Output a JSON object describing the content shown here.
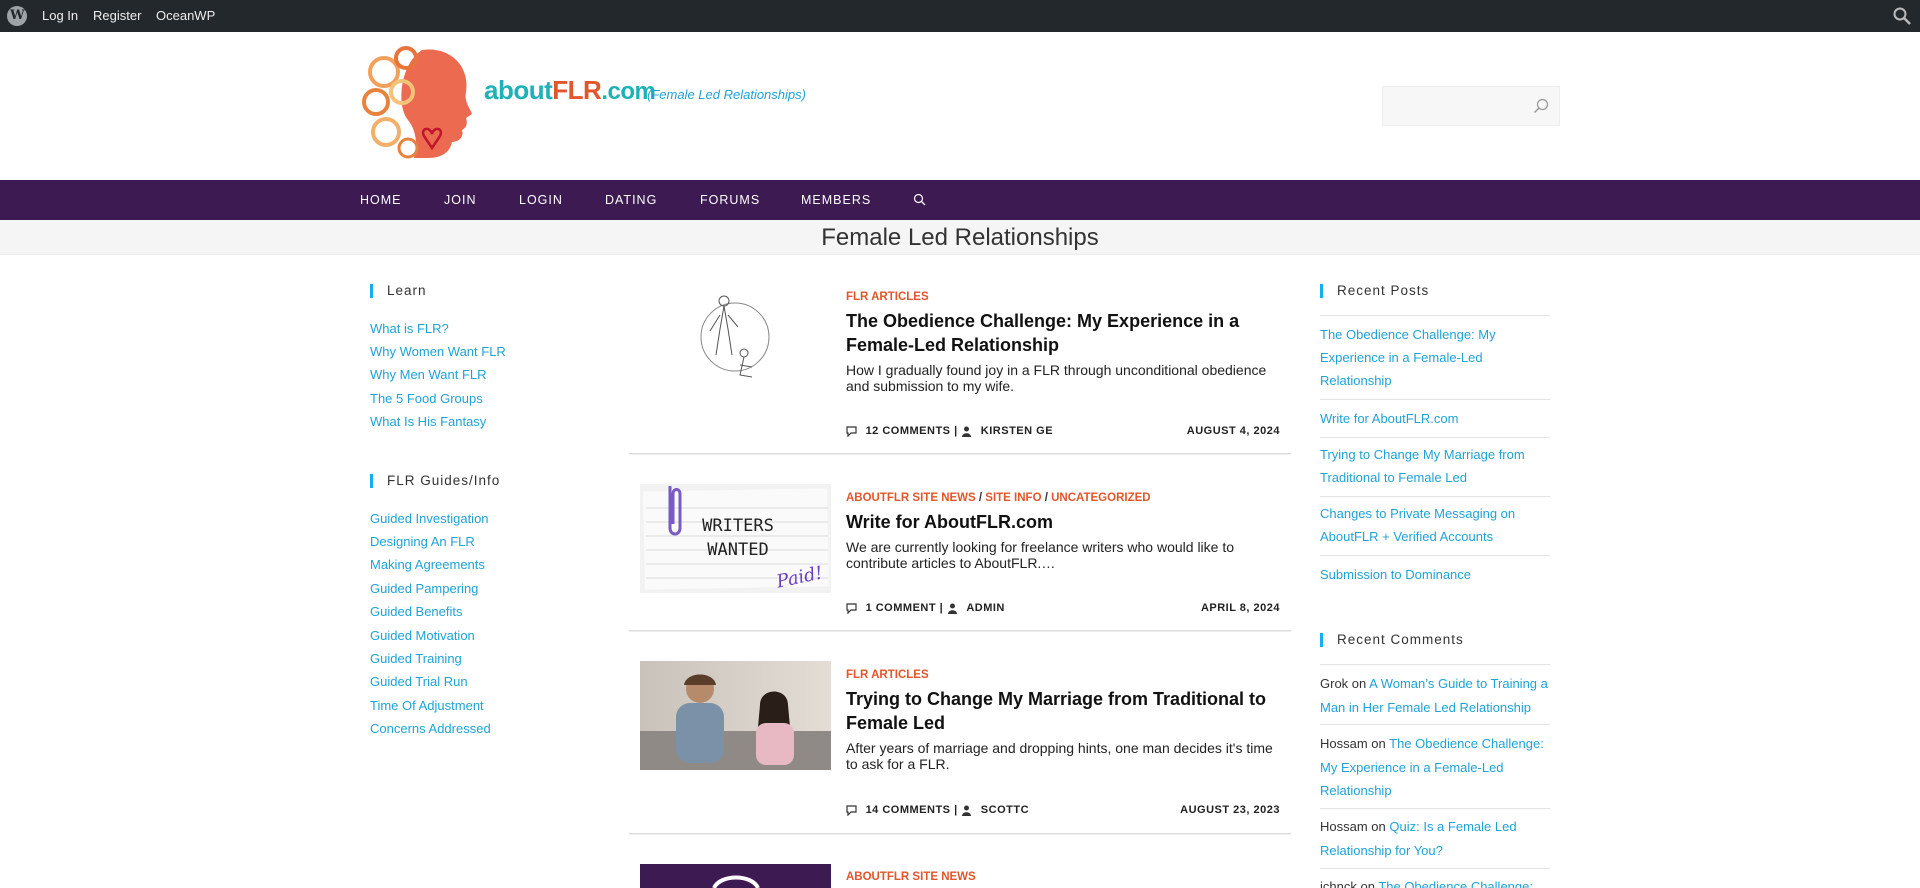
{
  "adminbar": {
    "links": [
      "Log In",
      "Register",
      "OceanWP"
    ]
  },
  "header": {
    "brand_about": "about",
    "brand_flr": "FLR",
    "brand_com": ".com",
    "tagline": "(Female Led Relationships)",
    "search_value": ""
  },
  "nav": {
    "items": [
      "HOME",
      "JOIN",
      "LOGIN",
      "DATING",
      "FORUMS",
      "MEMBERS"
    ]
  },
  "page": {
    "title": "Female Led Relationships"
  },
  "left_sidebar": {
    "learn_title": "Learn",
    "learn_links": [
      "What is FLR?",
      "Why Women Want FLR",
      "Why Men Want FLR",
      "The 5 Food Groups",
      "What Is His Fantasy"
    ],
    "guides_title": "FLR Guides/Info",
    "guides_links": [
      "Guided Investigation",
      "Designing An FLR",
      "Making Agreements",
      "Guided Pampering",
      "Guided Benefits",
      "Guided Motivation",
      "Guided Training",
      "Guided Trial Run",
      "Time Of Adjustment",
      "Concerns Addressed"
    ]
  },
  "posts": [
    {
      "categories": [
        "FLR ARTICLES"
      ],
      "title_lines": [
        "The Obedience Challenge: My Experience in a",
        "Female-Led Relationship"
      ],
      "excerpt_lines": [
        "How I gradually found joy in a FLR through unconditional obedience",
        "and submission to my wife."
      ],
      "comments": "12 COMMENTS",
      "author": "KIRSTEN GE",
      "date": "AUGUST 4, 2024"
    },
    {
      "categories": [
        "ABOUTFLR SITE NEWS",
        "SITE INFO",
        "UNCATEGORIZED"
      ],
      "title_lines": [
        "Write for AboutFLR.com"
      ],
      "excerpt_lines": [
        "We are currently looking for freelance writers who would like to",
        "contribute articles to AboutFLR.…"
      ],
      "comments": "1 COMMENT",
      "author": "ADMIN",
      "date": "APRIL 8, 2024",
      "thumb_text_1": "WRITERS",
      "thumb_text_2": "WANTED",
      "thumb_text_3": "Paid!"
    },
    {
      "categories": [
        "FLR ARTICLES"
      ],
      "title_lines": [
        "Trying to Change My Marriage from Traditional to",
        "Female Led"
      ],
      "excerpt_lines": [
        "After years of marriage and dropping hints, one man decides it's time",
        "to ask for a FLR."
      ],
      "comments": "14 COMMENTS",
      "author": "SCOTTC",
      "date": "AUGUST 23, 2023"
    },
    {
      "categories": [
        "ABOUTFLR SITE NEWS"
      ]
    }
  ],
  "right_sidebar": {
    "recent_posts_title": "Recent Posts",
    "recent_posts": [
      [
        "The Obedience Challenge: My",
        "Experience in a Female-Led",
        "Relationship"
      ],
      [
        "Write for AboutFLR.com"
      ],
      [
        "Trying to Change My Marriage from",
        "Traditional to Female Led"
      ],
      [
        "Changes to Private Messaging on",
        "AboutFLR + Verified Accounts"
      ],
      [
        "Submission to Dominance"
      ]
    ],
    "recent_comments_title": "Recent Comments",
    "recent_comments": [
      {
        "author": "Grok",
        "on": " on ",
        "lines": [
          "A Woman’s Guide to Training a",
          "Man in Her Female Led Relationship"
        ]
      },
      {
        "author": "Hossam",
        "on": " on ",
        "lines": [
          "The Obedience Challenge:",
          "My Experience in a Female-Led",
          "Relationship"
        ]
      },
      {
        "author": "Hossam",
        "on": " on ",
        "lines": [
          "Quiz: Is a Female Led",
          "Relationship for You?"
        ]
      },
      {
        "author": "jchnck",
        "on": " on ",
        "lines": [
          "The Obedience Challenge:"
        ]
      }
    ]
  },
  "colors": {
    "nav_bg": "#3d1a52",
    "link": "#1fa3d6",
    "category": "#e2562b",
    "accent_bar": "#13aff0"
  }
}
